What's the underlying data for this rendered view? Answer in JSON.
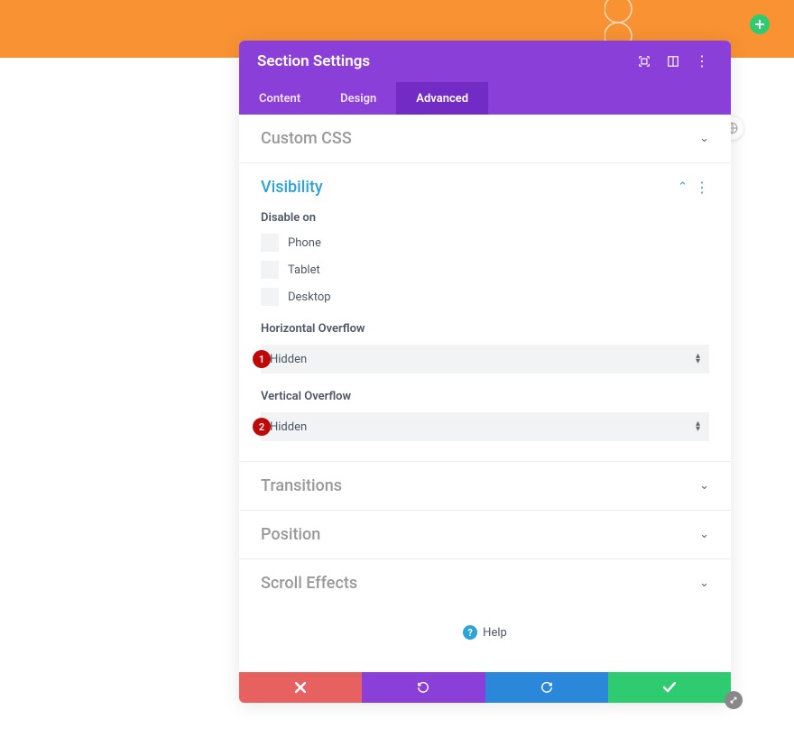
{
  "header": {
    "title": "Section Settings"
  },
  "tabs": {
    "content": "Content",
    "design": "Design",
    "advanced": "Advanced"
  },
  "panels": {
    "custom_css": "Custom CSS",
    "visibility": "Visibility",
    "transitions": "Transitions",
    "position": "Position",
    "scroll_effects": "Scroll Effects"
  },
  "visibility": {
    "disable_on_label": "Disable on",
    "options": {
      "phone": "Phone",
      "tablet": "Tablet",
      "desktop": "Desktop"
    },
    "horizontal_overflow_label": "Horizontal Overflow",
    "horizontal_overflow_value": "Hidden",
    "vertical_overflow_label": "Vertical Overflow",
    "vertical_overflow_value": "Hidden"
  },
  "badges": {
    "one": "1",
    "two": "2"
  },
  "help": "Help"
}
